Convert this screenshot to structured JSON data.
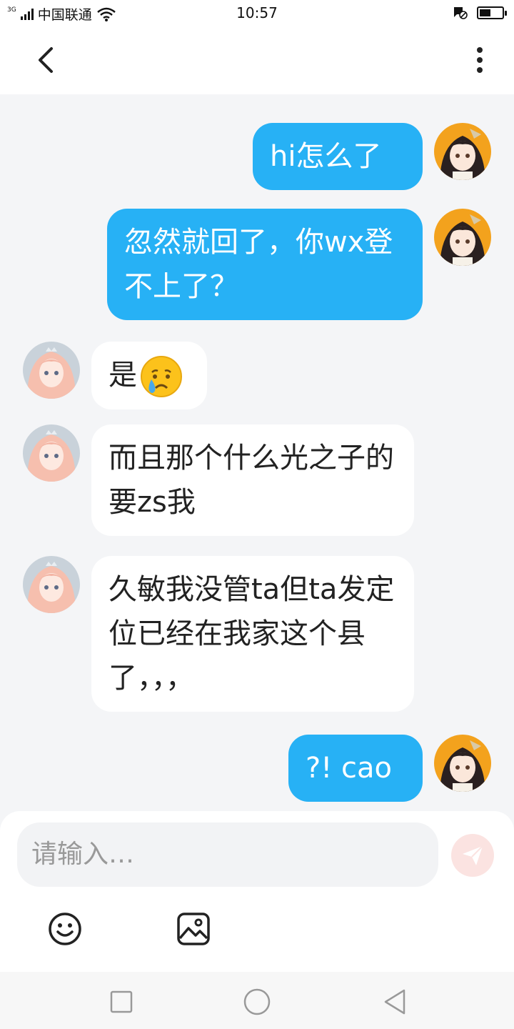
{
  "status_bar": {
    "network": "3G",
    "carrier": "中国联通",
    "time": "10:57",
    "battery_level": 0.5
  },
  "header": {
    "back_icon": "chevron-left-icon",
    "more_icon": "more-vertical-icon"
  },
  "colors": {
    "self_bubble": "#27b1f5",
    "other_bubble": "#ffffff",
    "send_button": "#f4a59c"
  },
  "messages": [
    {
      "from": "self",
      "text": "hi怎么了"
    },
    {
      "from": "self",
      "text": "忽然就回了，你wx登不上了？"
    },
    {
      "from": "other",
      "text": "是",
      "emoji": "crying-face"
    },
    {
      "from": "other",
      "text": "而且那个什么光之子的要zs我"
    },
    {
      "from": "other",
      "text": "久敏我没管ta但ta发定位已经在我家这个县了，，，"
    },
    {
      "from": "self",
      "text": "?! cao"
    }
  ],
  "input": {
    "placeholder": "请输入…"
  },
  "toolbar": {
    "emoji_icon": "smiley-icon",
    "image_icon": "image-icon"
  }
}
